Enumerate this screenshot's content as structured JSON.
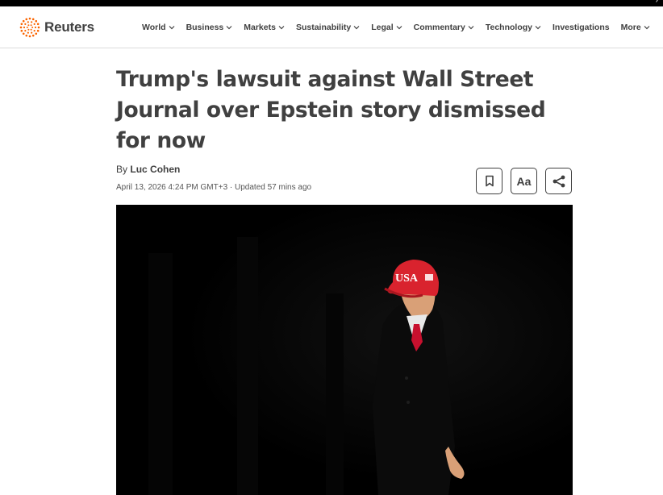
{
  "header": {
    "logo_text": "Reuters",
    "brand_color": "#fa6400",
    "nav": [
      {
        "label": "World",
        "has_dropdown": true
      },
      {
        "label": "Business",
        "has_dropdown": true
      },
      {
        "label": "Markets",
        "has_dropdown": true
      },
      {
        "label": "Sustainability",
        "has_dropdown": true
      },
      {
        "label": "Legal",
        "has_dropdown": true
      },
      {
        "label": "Commentary",
        "has_dropdown": true
      },
      {
        "label": "Technology",
        "has_dropdown": true
      },
      {
        "label": "Investigations",
        "has_dropdown": false
      },
      {
        "label": "More",
        "has_dropdown": true
      }
    ]
  },
  "article": {
    "headline": "Trump's lawsuit against Wall Street Journal over Epstein story dismissed for now",
    "by_prefix": "By",
    "author": "Luc Cohen",
    "dateline": "April 13, 2026 4:24 PM GMT+3 · Updated 57 mins ago",
    "actions": {
      "bookmark_icon": "bookmark-icon",
      "text_size_label": "Aa",
      "share_icon": "share-icon"
    },
    "photo": {
      "cap_text": "USA",
      "cap_color": "#d9232e",
      "tie_color": "#c8102e"
    }
  }
}
